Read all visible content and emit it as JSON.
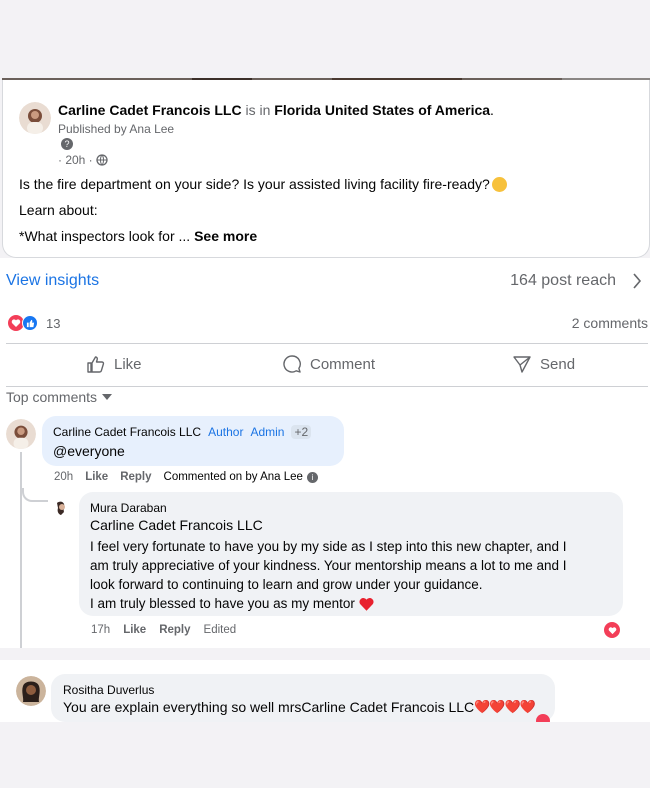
{
  "post": {
    "page_name": "Carline Cadet Francois LLC",
    "is_in_text": "is in",
    "location": "Florida United States of America",
    "location_suffix": ".",
    "published_by": "Published by Ana Lee",
    "time": "· 20h ·",
    "body_line1": "Is the fire department on your side? Is your assisted living facility fire-ready?",
    "body_line2": "Learn about:",
    "body_line3": "*What inspectors look for ... ",
    "see_more": "See more"
  },
  "insights": {
    "view_insights": "View insights",
    "post_reach": "164 post reach"
  },
  "reactions": {
    "count": "13",
    "comments": "2 comments"
  },
  "actions": {
    "like": "Like",
    "comment": "Comment",
    "send": "Send"
  },
  "comments_filter": "Top comments",
  "comment1": {
    "author": "Carline Cadet Francois LLC",
    "badge_author": "Author",
    "badge_admin": "Admin",
    "badge_more": "+2",
    "text": "@everyone",
    "time": "20h",
    "like": "Like",
    "reply": "Reply",
    "commented_on_by": "Commented on by",
    "commented_name": "Ana Lee"
  },
  "reply1": {
    "author": "Mura Daraban",
    "mention": "Carline Cadet Francois LLC",
    "line1": "I feel very fortunate to have you by my side as I step into this new chapter, and I",
    "line2": "am truly appreciative of your kindness. Your mentorship means a lot to me and I",
    "line3": "look forward to continuing to learn and grow under your guidance.",
    "line4": "I am truly blessed to have you as my mentor",
    "time": "17h",
    "like": "Like",
    "reply": "Reply",
    "edited": "Edited"
  },
  "comment2": {
    "author": "Rositha Duverlus",
    "text_prefix": "You are explain everything so well mrs ",
    "mention": "Carline Cadet Francois LLC",
    "hearts": "❤️❤️❤️❤️"
  },
  "colors": {
    "link_blue": "#1b74e4",
    "heart_red": "#f33e58",
    "like_blue": "#1877f2",
    "muted_gray": "#65676b"
  }
}
